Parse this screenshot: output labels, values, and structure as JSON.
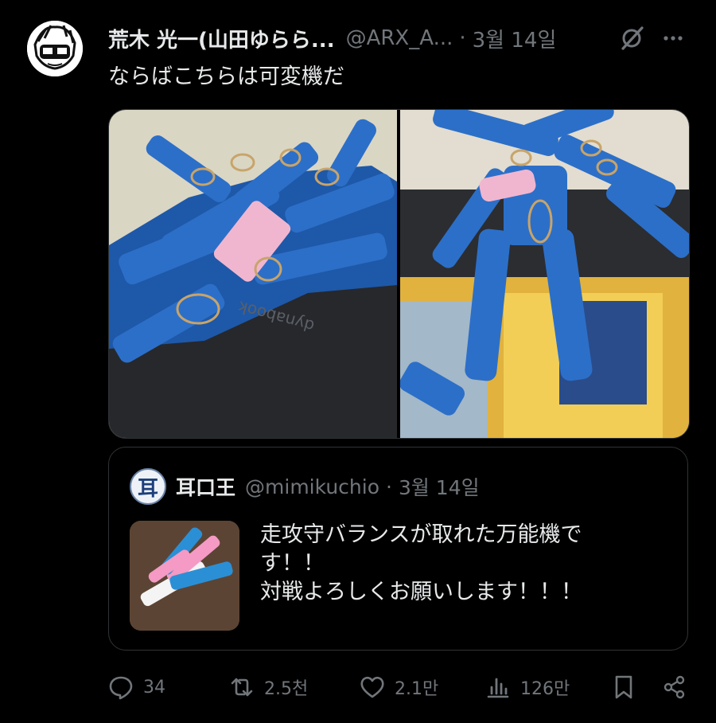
{
  "tweet": {
    "author_name": "荒木 光一(山田ゆらら...",
    "author_handle": "@ARX_A...",
    "separator": "·",
    "date": "3월 14일",
    "text": "ならばこちらは可変機だ"
  },
  "quote": {
    "avatar_glyph": "耳",
    "author_name": "耳口王",
    "author_handle": "@mimikuchio",
    "separator": "·",
    "date": "3월 14일",
    "text": "走攻守バランスが取れた万能機で\nす！！\n対戦よろしくお願いします！！！"
  },
  "actions": {
    "replies": "34",
    "reposts": "2.5천",
    "likes": "2.1만",
    "views": "126만"
  },
  "icons": {
    "reply": "reply-icon",
    "repost": "repost-icon",
    "like": "heart-icon",
    "views": "views-icon",
    "bookmark": "bookmark-icon",
    "share": "share-icon",
    "grok": "grok-icon",
    "more": "more-icon"
  },
  "colors": {
    "background": "#000000",
    "text": "#e7e9ea",
    "muted": "#71767b",
    "border": "#2f3336"
  }
}
